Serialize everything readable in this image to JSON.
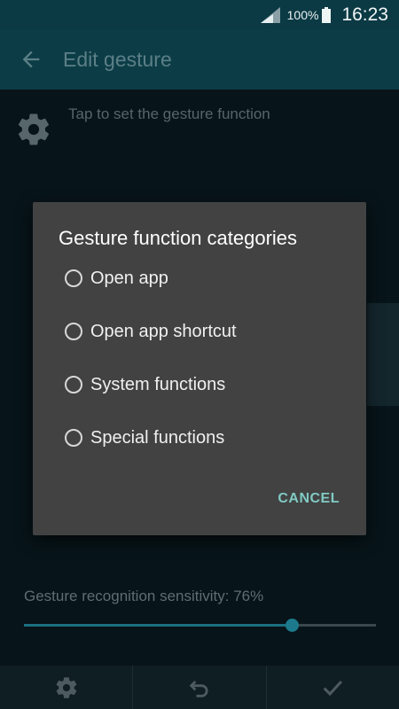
{
  "status_bar": {
    "battery_percent": "100%",
    "time": "16:23"
  },
  "app_bar": {
    "title": "Edit gesture"
  },
  "content": {
    "hint": "Tap to set the gesture function",
    "sensitivity_label": "Gesture recognition sensitivity: 76%",
    "sensitivity_value": 0.76
  },
  "dialog": {
    "title": "Gesture function categories",
    "options": [
      {
        "label": "Open app"
      },
      {
        "label": "Open app shortcut"
      },
      {
        "label": "System functions"
      },
      {
        "label": "Special functions"
      }
    ],
    "cancel_label": "CANCEL"
  },
  "bottom_bar": {
    "icons": [
      "gear-icon",
      "undo-icon",
      "check-icon"
    ]
  },
  "colors": {
    "accent": "#80cbc4",
    "app_bar": "#0c3d47",
    "dialog_bg": "#424242"
  }
}
